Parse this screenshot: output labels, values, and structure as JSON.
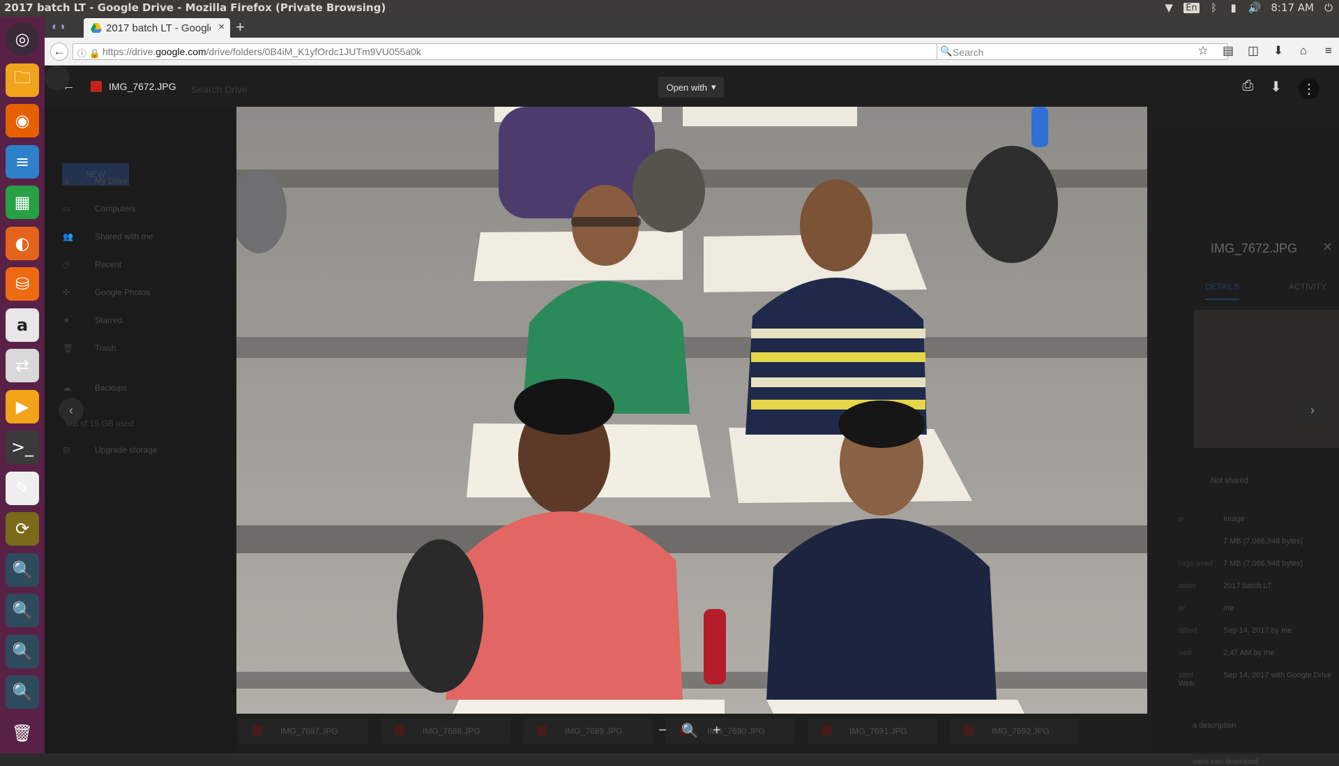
{
  "window": {
    "title": "2017 batch LT - Google Drive - Mozilla Firefox (Private Browsing)"
  },
  "system": {
    "language": "En",
    "clock": "8:17 AM",
    "indicators": [
      "wifi-icon",
      "bluetooth-icon",
      "battery-icon",
      "volume-icon",
      "power-icon"
    ]
  },
  "launcher": {
    "items": [
      {
        "name": "ubuntu-dash",
        "glyph": "◎",
        "color": "#3b2a3a"
      },
      {
        "name": "files",
        "glyph": "🗀",
        "color": "#f0a41c"
      },
      {
        "name": "firefox",
        "glyph": "◉",
        "color": "#e66000"
      },
      {
        "name": "libreoffice-writer",
        "glyph": "≡",
        "color": "#2e80c9"
      },
      {
        "name": "libreoffice-calc",
        "glyph": "▦",
        "color": "#27a046"
      },
      {
        "name": "libreoffice-impress",
        "glyph": "◐",
        "color": "#e5641c"
      },
      {
        "name": "software-center",
        "glyph": "⛁",
        "color": "#ee6a12"
      },
      {
        "name": "amazon",
        "glyph": "a",
        "color": "#e7e7e7"
      },
      {
        "name": "settings-toggle",
        "glyph": "⇄",
        "color": "#d8d8d8"
      },
      {
        "name": "media-player",
        "glyph": "▶",
        "color": "#f2a31a"
      },
      {
        "name": "terminal",
        "glyph": ">_",
        "color": "#3a3a3a"
      },
      {
        "name": "text-editor",
        "glyph": "✎",
        "color": "#eeeeee"
      },
      {
        "name": "update-manager",
        "glyph": "⟳",
        "color": "#7a6a1a"
      },
      {
        "name": "image-viewer-1",
        "glyph": "🔍",
        "color": "#2d4b5c"
      },
      {
        "name": "image-viewer-2",
        "glyph": "🔍",
        "color": "#2d4b5c"
      },
      {
        "name": "image-viewer-3",
        "glyph": "🔍",
        "color": "#2d4b5c"
      },
      {
        "name": "image-viewer-4",
        "glyph": "🔍",
        "color": "#2d4b5c"
      },
      {
        "name": "trash",
        "glyph": "🗑",
        "color": "#5a2147"
      }
    ]
  },
  "browser": {
    "tab_label": "2017 batch LT - Google",
    "tab_close": "×",
    "new_tab": "+",
    "url_prefix": "https://drive.",
    "url_domain": "google.com",
    "url_rest": "/drive/folders/0B4iM_K1yfOrdc1JUTm9VU055a0k",
    "search_placeholder": "Search"
  },
  "drive": {
    "new_button": "NEW",
    "nav": [
      {
        "label": "My Drive",
        "icon": "drive-icon"
      },
      {
        "label": "Computers",
        "icon": "computer-icon"
      },
      {
        "label": "Shared with me",
        "icon": "people-icon"
      },
      {
        "label": "Recent",
        "icon": "clock-icon"
      },
      {
        "label": "Google Photos",
        "icon": "photos-icon"
      },
      {
        "label": "Starred",
        "icon": "star-icon"
      },
      {
        "label": "Trash",
        "icon": "trash-icon"
      },
      {
        "label": "Backups",
        "icon": "cloud-icon"
      }
    ],
    "storage_text": "MB of 15 GB used",
    "upgrade_text": "Upgrade storage",
    "search_hint": "Search Drive"
  },
  "viewer": {
    "filename": "IMG_7672.JPG",
    "open_with": "Open with",
    "filmstrip": [
      "IMG_7687.JPG",
      "IMG_7688.JPG",
      "IMG_7689.JPG",
      "IMG_7690.JPG",
      "IMG_7691.JPG",
      "IMG_7692.JPG"
    ],
    "filmstrip_partial": "IM",
    "filmstrip_partial_tail": "90.JPG"
  },
  "details": {
    "title": "IMG_7672.JPG",
    "tab_details": "DETAILS",
    "tab_activity": "ACTIVITY",
    "not_shared": "Not shared",
    "rows": [
      {
        "label": "e",
        "value": "Image"
      },
      {
        "label": "",
        "value": "7 MB (7,066,948 bytes)"
      },
      {
        "label": "rage used",
        "value": "7 MB (7,066,948 bytes)"
      },
      {
        "label": "ation",
        "value": "2017 batch LT"
      },
      {
        "label": "er",
        "value": "me"
      },
      {
        "label": "dified",
        "value": "Sep 14, 2017 by me"
      },
      {
        "label": "ned",
        "value": "2:47 AM by me"
      },
      {
        "label": "ated",
        "value": "Sep 14, 2017 with Google Drive Web"
      }
    ],
    "description": "a description",
    "viewers": "wers can download"
  }
}
